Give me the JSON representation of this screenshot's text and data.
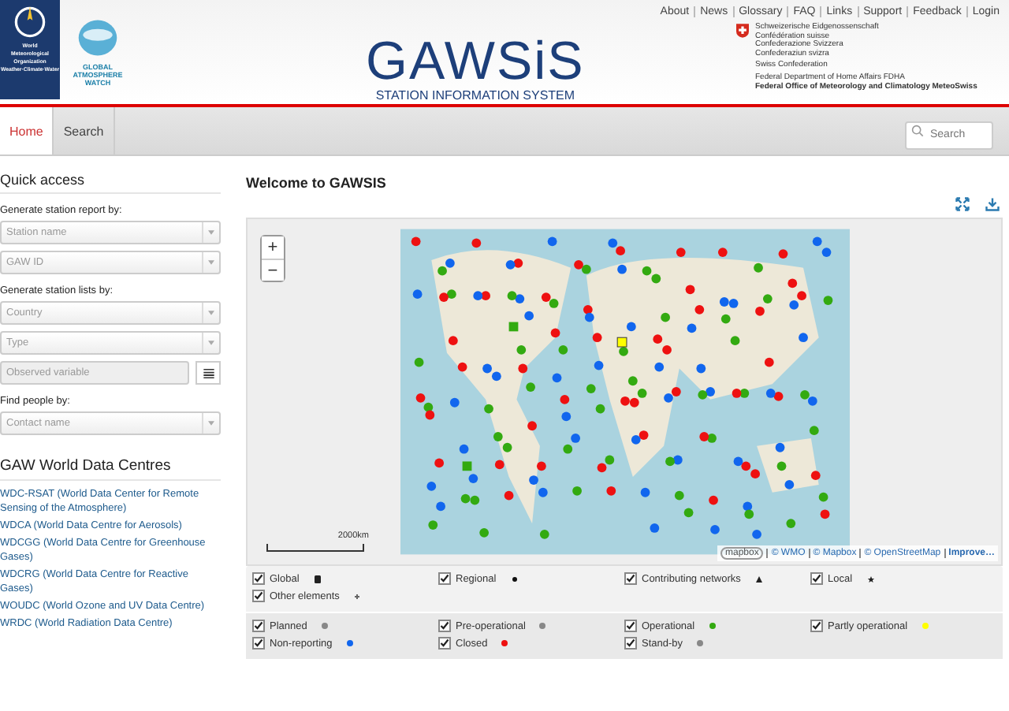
{
  "header": {
    "wmo_logo_lines": [
      "World",
      "Meteorological",
      "Organization",
      "Weather·Climate·Water"
    ],
    "gaw_logo_lines": [
      "GLOBAL",
      "ATMOSPHERE",
      "WATCH"
    ],
    "title": "GAWSiS",
    "subtitle": "STATION INFORMATION SYSTEM",
    "top_links": [
      "About",
      "News",
      "Glossary",
      "FAQ",
      "Links",
      "Support",
      "Feedback",
      "Login"
    ],
    "swiss_lines": [
      "Schweizerische Eidgenossenschaft",
      "Confédération suisse",
      "Confederazione Svizzera",
      "Confederaziun svizra"
    ],
    "swiss_english": "Swiss Confederation",
    "swiss_dept": "Federal Department of Home Affairs FDHA",
    "swiss_office": "Federal Office of Meteorology and Climatology MeteoSwiss"
  },
  "tabs": [
    {
      "label": "Home",
      "selected": true
    },
    {
      "label": "Search",
      "selected": false
    }
  ],
  "search": {
    "placeholder": "Search"
  },
  "sidebar": {
    "title": "Quick access",
    "groups": [
      {
        "label": "Generate station report by:",
        "fields": [
          {
            "kind": "select",
            "placeholder": "Station name"
          },
          {
            "kind": "select",
            "placeholder": "GAW ID"
          }
        ]
      },
      {
        "label": "Generate station lists by:",
        "fields": [
          {
            "kind": "select",
            "placeholder": "Country"
          },
          {
            "kind": "select",
            "placeholder": "Type"
          },
          {
            "kind": "list",
            "placeholder": "Observed variable"
          }
        ]
      },
      {
        "label": "Find people by:",
        "fields": [
          {
            "kind": "select",
            "placeholder": "Contact name"
          }
        ]
      }
    ],
    "centres_title": "GAW World Data Centres",
    "centres": [
      "WDC-RSAT (World Data Center for Remote Sensing of the Atmosphere)",
      "WDCA (World Data Centre for Aerosols)",
      "WDCGG (World Data Centre for Greenhouse Gases)",
      "WDCRG (World Data Centre for Reactive Gases)",
      "WOUDC (World Ozone and UV Data Centre)",
      "WRDC (World Radiation Data Centre)"
    ]
  },
  "main": {
    "title": "Welcome to GAWSIS",
    "map": {
      "zoom_in": "+",
      "zoom_out": "−",
      "scale": "2000km",
      "attribution": [
        "© WMO",
        "© Mapbox",
        "© OpenStreetMap",
        "Improve…"
      ],
      "mapbox_logo": "mapbox"
    },
    "layer_legend": [
      {
        "label": "Global",
        "checked": true,
        "kind": "square",
        "color": "#222222"
      },
      {
        "label": "Regional",
        "checked": true,
        "kind": "dot",
        "color": "#111111"
      },
      {
        "label": "Contributing networks",
        "checked": true,
        "kind": "triangle",
        "color": "#222222"
      },
      {
        "label": "Local",
        "checked": true,
        "kind": "star",
        "color": "#222222"
      },
      {
        "label": "Other elements",
        "checked": true,
        "kind": "plus",
        "color": "#666666"
      }
    ],
    "status_legend": [
      {
        "label": "Planned",
        "checked": true,
        "color": "#888888"
      },
      {
        "label": "Pre-operational",
        "checked": true,
        "color": "#888888"
      },
      {
        "label": "Operational",
        "checked": true,
        "color": "#33aa11"
      },
      {
        "label": "Partly operational",
        "checked": true,
        "color": "#ffff00"
      },
      {
        "label": "Non-reporting",
        "checked": true,
        "color": "#1166ee"
      },
      {
        "label": "Closed",
        "checked": true,
        "color": "#ee1111"
      },
      {
        "label": "Stand-by",
        "checked": true,
        "color": "#888888"
      }
    ]
  }
}
